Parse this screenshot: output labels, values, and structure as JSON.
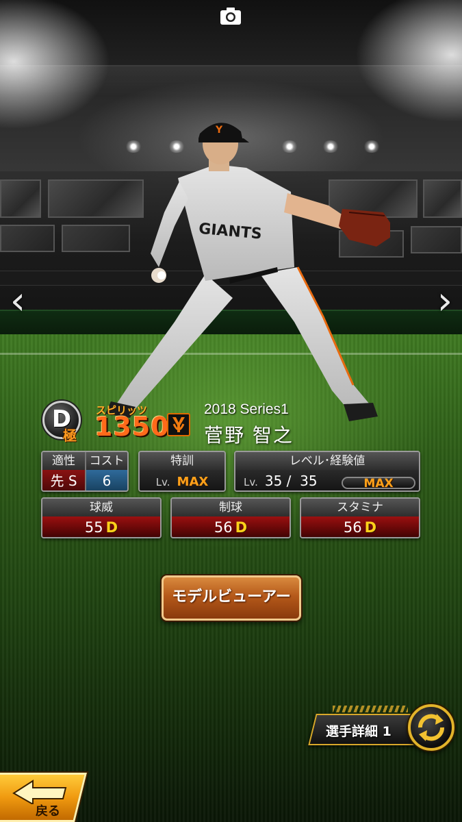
{
  "screen": {
    "accent_orange": "#ff6a1a",
    "gold": "#e2b32a"
  },
  "top": {
    "camera_icon": "camera-icon"
  },
  "nav": {
    "prev_icon": "chevron-left-icon",
    "next_icon": "chevron-right-icon",
    "prev": "‹",
    "next": "›"
  },
  "player": {
    "rank": "D",
    "rank_sub": "極",
    "spirits_label": "スピリッツ",
    "spirits": "1350",
    "team_logo": "giants-logo",
    "series": "2018 Series1",
    "name": "菅野 智之"
  },
  "stats": {
    "aptitude_label": "適性",
    "aptitude_value": "先 S",
    "cost_label": "コスト",
    "cost_value": "6",
    "training_label": "特訓",
    "training_lv": "Lv.",
    "training_value": "MAX",
    "level_label": "レベル･経験値",
    "level_lv": "Lv.",
    "level_value": "35 /  35",
    "level_exp": "MAX"
  },
  "abilities": [
    {
      "label": "球威",
      "value": "55",
      "grade": "D"
    },
    {
      "label": "制球",
      "value": "56",
      "grade": "D"
    },
    {
      "label": "スタミナ",
      "value": "56",
      "grade": "D"
    }
  ],
  "buttons": {
    "model_viewer": "モデルビューアー",
    "player_detail": "選手詳細 1",
    "swap_icon": "swap-icon",
    "back": "戻る",
    "back_icon": "back-arrow-icon"
  }
}
